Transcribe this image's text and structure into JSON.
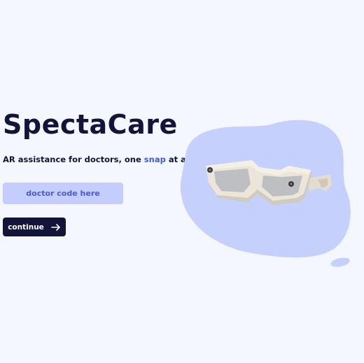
{
  "app": {
    "title": "SpectaCare",
    "tagline_before": "AR assistance for doctors, one ",
    "tagline_accent": "snap",
    "tagline_after": " at a time."
  },
  "form": {
    "code_placeholder": "doctor code here",
    "code_value": "",
    "continue_label": "continue"
  },
  "icons": {
    "continue": "arrow-right-icon",
    "hero": "ar-glasses-illustration"
  },
  "colors": {
    "background": "#f4f7fe",
    "primary_dark": "#12143a",
    "accent": "#3f5fd0",
    "input_bg": "#c4cdfc",
    "blob": "#c5d0fd"
  }
}
